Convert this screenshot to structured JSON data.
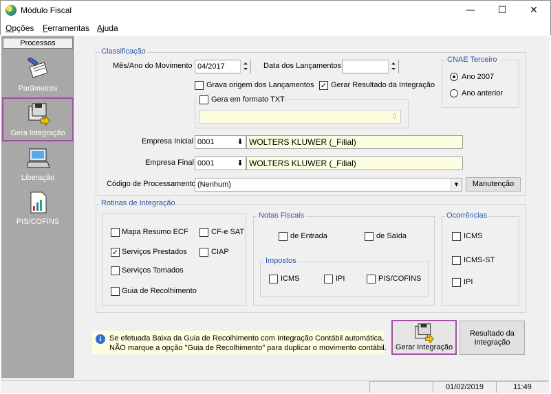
{
  "window": {
    "title": "Módulo Fiscal",
    "min": "—",
    "max": "☐",
    "close": "✕"
  },
  "menu": [
    {
      "label": "Opções",
      "key": "O",
      "rest": "pções"
    },
    {
      "label": "Ferramentas",
      "key": "F",
      "rest": "erramentas"
    },
    {
      "label": "Ajuda",
      "key": "A",
      "rest": "juda"
    }
  ],
  "sidebar": {
    "header": "Processos",
    "items": [
      {
        "label": "Parâmetros",
        "icon": "parameters-icon"
      },
      {
        "label": "Gera Integração",
        "icon": "floppy-integration-icon"
      },
      {
        "label": "Liberação",
        "icon": "computer-release-icon"
      },
      {
        "label": "PIS/COFINS",
        "icon": "document-chart-icon"
      }
    ]
  },
  "classificacao": {
    "title": "Classificação",
    "mes_ano_label": "Mês/Ano do Movimento",
    "mes_ano_value": "04/2017",
    "data_lanc_label": "Data dos Lançamentos",
    "data_lanc_value": "",
    "grava_origem": {
      "label": "Grava origem dos Lançamentos",
      "checked": false
    },
    "gerar_resultado": {
      "label": "Gerar Resultado da Integração",
      "checked": true
    },
    "gera_txt": {
      "label": "Gera em formato TXT",
      "checked": false,
      "path": ""
    },
    "empresa_inicial_label": "Empresa Inicial",
    "empresa_inicial_code": "0001",
    "empresa_inicial_name": "WOLTERS KLUWER (_Filial)",
    "empresa_final_label": "Empresa Final",
    "empresa_final_code": "0001",
    "empresa_final_name": "WOLTERS KLUWER (_Filial)",
    "codigo_label": "Código de Processamento",
    "codigo_value": "(Nenhum)",
    "manutencao": "Manutenção"
  },
  "cnae": {
    "title": "CNAE Terceiro",
    "options": [
      {
        "label": "Ano 2007",
        "selected": true
      },
      {
        "label": "Ano anterior",
        "selected": false
      }
    ]
  },
  "rotinas": {
    "title": "Rotinas de Integração",
    "items": [
      {
        "label": "Mapa Resumo ECF",
        "checked": false
      },
      {
        "label": "CF-e SAT",
        "checked": false
      },
      {
        "label": "Serviços Prestados",
        "checked": true
      },
      {
        "label": "CIAP",
        "checked": false
      },
      {
        "label": "Serviços Tomados",
        "checked": false
      },
      {
        "label": "Guia de Recolhimento",
        "checked": false
      }
    ]
  },
  "notas": {
    "title": "Notas Fiscais",
    "entrada": "de Entrada",
    "saida": "de Saída",
    "impostos_title": "Impostos",
    "impostos": [
      "ICMS",
      "IPI",
      "PIS/COFINS"
    ]
  },
  "ocorrencias": {
    "title": "Ocorrências",
    "items": [
      "ICMS",
      "ICMS-ST",
      "IPI"
    ]
  },
  "info": {
    "line1": "Se efetuada Baixa da Guia de Recolhimento com Integração Contábil automática,",
    "line2": "NÃO marque a opção \"Guia de Recolhimento\" para duplicar o movimento contábil."
  },
  "actions": {
    "gerar": "Gerar Integração",
    "resultado_1": "Resultado da",
    "resultado_2": "Integração"
  },
  "status": {
    "date": "01/02/2019",
    "time": "11:49"
  },
  "colors": {
    "highlight": "#a34ea3",
    "group_title": "#2b55a8",
    "sidebar": "#a8a8a8",
    "yellow_field": "#fdfde0"
  }
}
